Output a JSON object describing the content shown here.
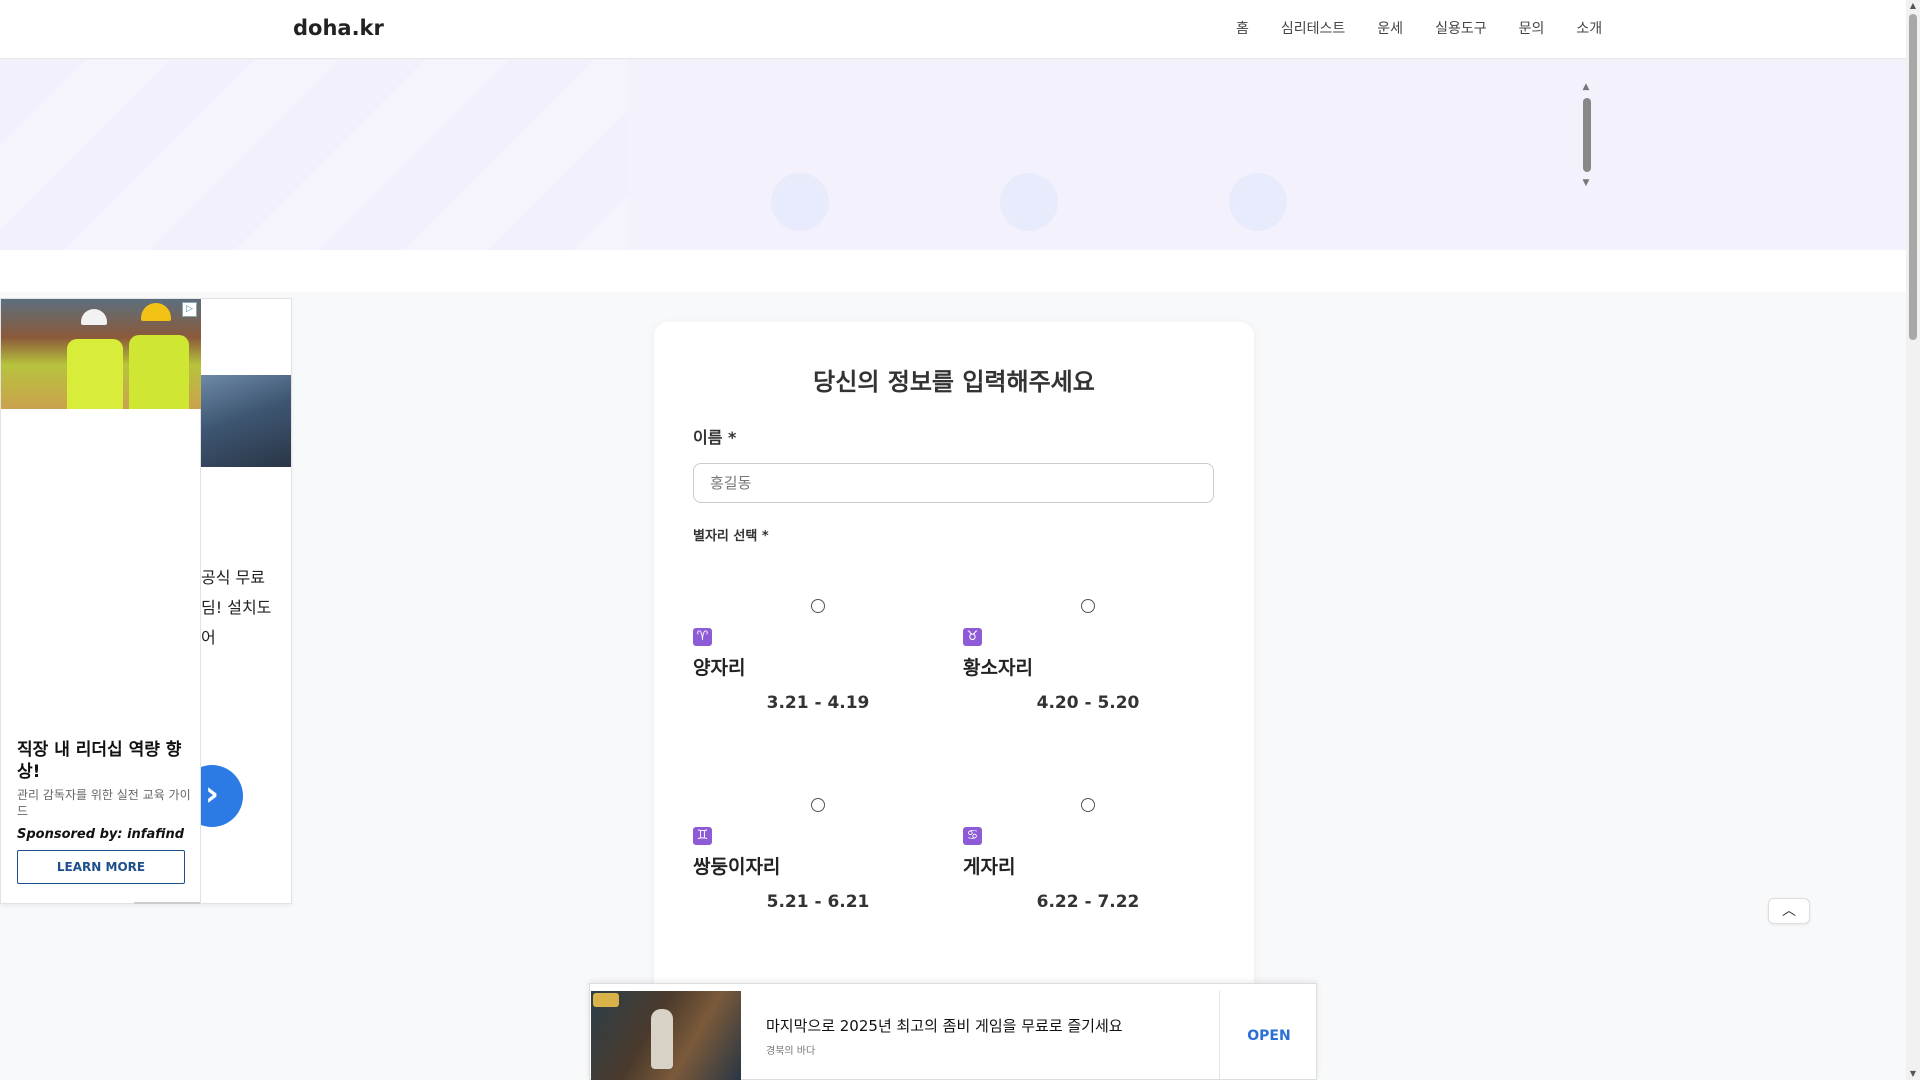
{
  "header": {
    "logo": "doha.kr",
    "nav": [
      "홈",
      "심리테스트",
      "운세",
      "실용도구",
      "문의",
      "소개"
    ]
  },
  "hero": {
    "scroll_up": "▲",
    "scroll_down": "▼"
  },
  "left_ad": {
    "underlying_text": [
      "공식 무료",
      "딤! 설치도",
      "어"
    ],
    "underlying_arrow": "›",
    "adchoices": "▷",
    "title": "직장 내 리더십 역량 향상!",
    "description": "관리 감독자를 위한 실전 교육 가이드",
    "sponsor": "Sponsored by: infafind",
    "button": "LEARN MORE"
  },
  "form": {
    "title": "당신의 정보를 입력해주세요",
    "name_label": "이름 *",
    "name_placeholder": "홍길동",
    "zodiac_label": "별자리 선택 *",
    "zodiac_options": [
      {
        "symbol": "♈",
        "name": "양자리",
        "dates": "3.21 - 4.19"
      },
      {
        "symbol": "♉",
        "name": "황소자리",
        "dates": "4.20 - 5.20"
      },
      {
        "symbol": "♊",
        "name": "쌍둥이자리",
        "dates": "5.21 - 6.21"
      },
      {
        "symbol": "♋",
        "name": "게자리",
        "dates": "6.22 - 7.22"
      }
    ]
  },
  "scroll_top": "︿",
  "bottom_ad": {
    "title": "마지막으로 2025년 최고의 좀비 게임을 무료로 즐기세요",
    "subtitle": "경북의 바다",
    "button": "OPEN"
  },
  "colors": {
    "accent": "#2a6fd6",
    "zodiac_icon": "#8e5bd6",
    "hero_bg": "#f3f2fc"
  }
}
